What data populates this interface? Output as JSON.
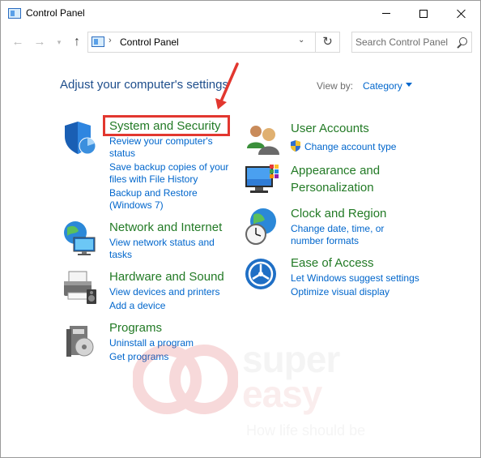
{
  "window": {
    "title": "Control Panel"
  },
  "address": {
    "path": "Control Panel"
  },
  "search": {
    "placeholder": "Search Control Panel"
  },
  "header": {
    "heading": "Adjust your computer's settings",
    "view_by_label": "View by:",
    "view_by_value": "Category"
  },
  "categories": {
    "system_security": {
      "title": "System and Security",
      "links": [
        "Review your computer's",
        "status",
        "Save backup copies of your",
        "files with File History",
        "Backup and Restore",
        "(Windows 7)"
      ]
    },
    "network": {
      "title": "Network and Internet",
      "links": [
        "View network status and",
        "tasks"
      ]
    },
    "hardware": {
      "title": "Hardware and Sound",
      "links": [
        "View devices and printers",
        "Add a device"
      ]
    },
    "programs": {
      "title": "Programs",
      "links": [
        "Uninstall a program",
        "Get programs"
      ]
    },
    "user_accounts": {
      "title": "User Accounts",
      "links": [
        "Change account type"
      ]
    },
    "appearance": {
      "title": "Appearance and",
      "title2": "Personalization"
    },
    "clock": {
      "title": "Clock and Region",
      "links": [
        "Change date, time, or",
        "number formats"
      ]
    },
    "ease": {
      "title": "Ease of Access",
      "links": [
        "Let Windows suggest settings",
        "Optimize visual display"
      ]
    }
  },
  "watermark": {
    "line1": "super",
    "line2": "easy",
    "tagline": "How life should be"
  },
  "colors": {
    "accent_link": "#0066cc",
    "category_title": "#227a25",
    "annotation": "#e2372f",
    "heading": "#1e4e8c"
  }
}
